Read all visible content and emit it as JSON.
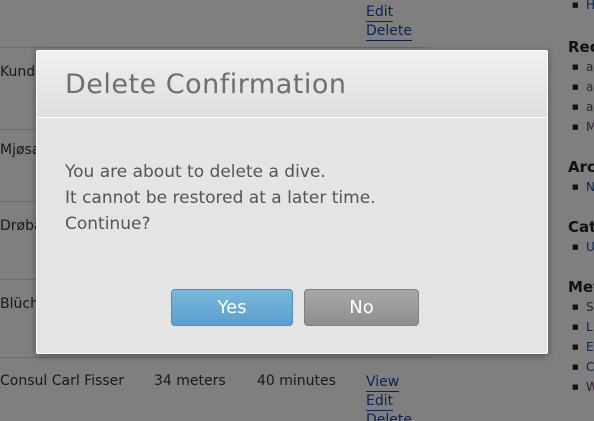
{
  "dives": [
    {
      "name": "Kunde",
      "depth": "",
      "time": "",
      "actions": []
    },
    {
      "name": "Mjøsa",
      "depth": "",
      "time": "",
      "actions": []
    },
    {
      "name": "Drøba",
      "depth": "",
      "time": "",
      "actions": []
    },
    {
      "name": "Blüche",
      "depth": "",
      "time": "",
      "actions": []
    },
    {
      "name": "Consul Carl Fisser",
      "depth": "34 meters",
      "time": "40 minutes",
      "actions": [
        "View",
        "Edit",
        "Delete"
      ]
    }
  ],
  "top_actions": [
    "Edit",
    "Delete"
  ],
  "sidebar": {
    "top_item": "H",
    "sections": [
      {
        "heading": "Rec",
        "items": [
          "a",
          "a",
          "a",
          "M"
        ]
      },
      {
        "heading": "Arc",
        "items": [
          "N"
        ]
      },
      {
        "heading": "Cat",
        "items": [
          "U"
        ]
      },
      {
        "heading": "Met",
        "items": [
          "S",
          "L",
          "E",
          "C",
          "W"
        ]
      }
    ]
  },
  "modal": {
    "title": "Delete Confirmation",
    "lines": [
      "You are about to delete a dive.",
      "It cannot be restored at a later time.",
      "Continue?"
    ],
    "yes_label": "Yes",
    "no_label": "No"
  },
  "colors": {
    "overlay": "#000000",
    "yes_button": "#5a9ecc",
    "no_button": "#8e8e8e",
    "link": "#1a4aa8"
  }
}
